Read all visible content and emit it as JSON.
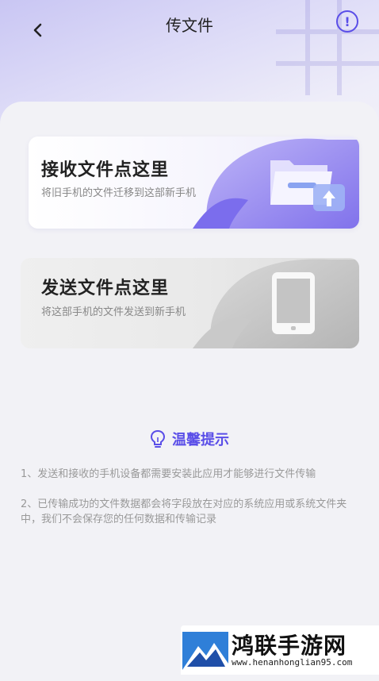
{
  "header": {
    "title": "传文件",
    "back_icon": "chevron-left-icon",
    "info_icon": "exclamation-circle-icon",
    "info_label": "!"
  },
  "cards": {
    "receive": {
      "title": "接收文件点这里",
      "description": "将旧手机的文件迁移到这部新手机",
      "icon": "folder-upload-icon"
    },
    "send": {
      "title": "发送文件点这里",
      "description": "将这部手机的文件发送到新手机",
      "icon": "phone-icon"
    }
  },
  "tips": {
    "title": "温馨提示",
    "icon": "lightbulb-icon",
    "line1": "1、发送和接收的手机设备都需要安装此应用才能够进行文件传输",
    "line2": "2、已传输成功的文件数据都会将字段放在对应的系统应用或系统文件夹中，我们不会保存您的任何数据和传输记录"
  },
  "watermark": {
    "name": "鸿联手游网",
    "url": "www.henanhonglian95.com"
  },
  "colors": {
    "accent": "#5a4ee8",
    "accent_light": "#9b8ff2"
  }
}
